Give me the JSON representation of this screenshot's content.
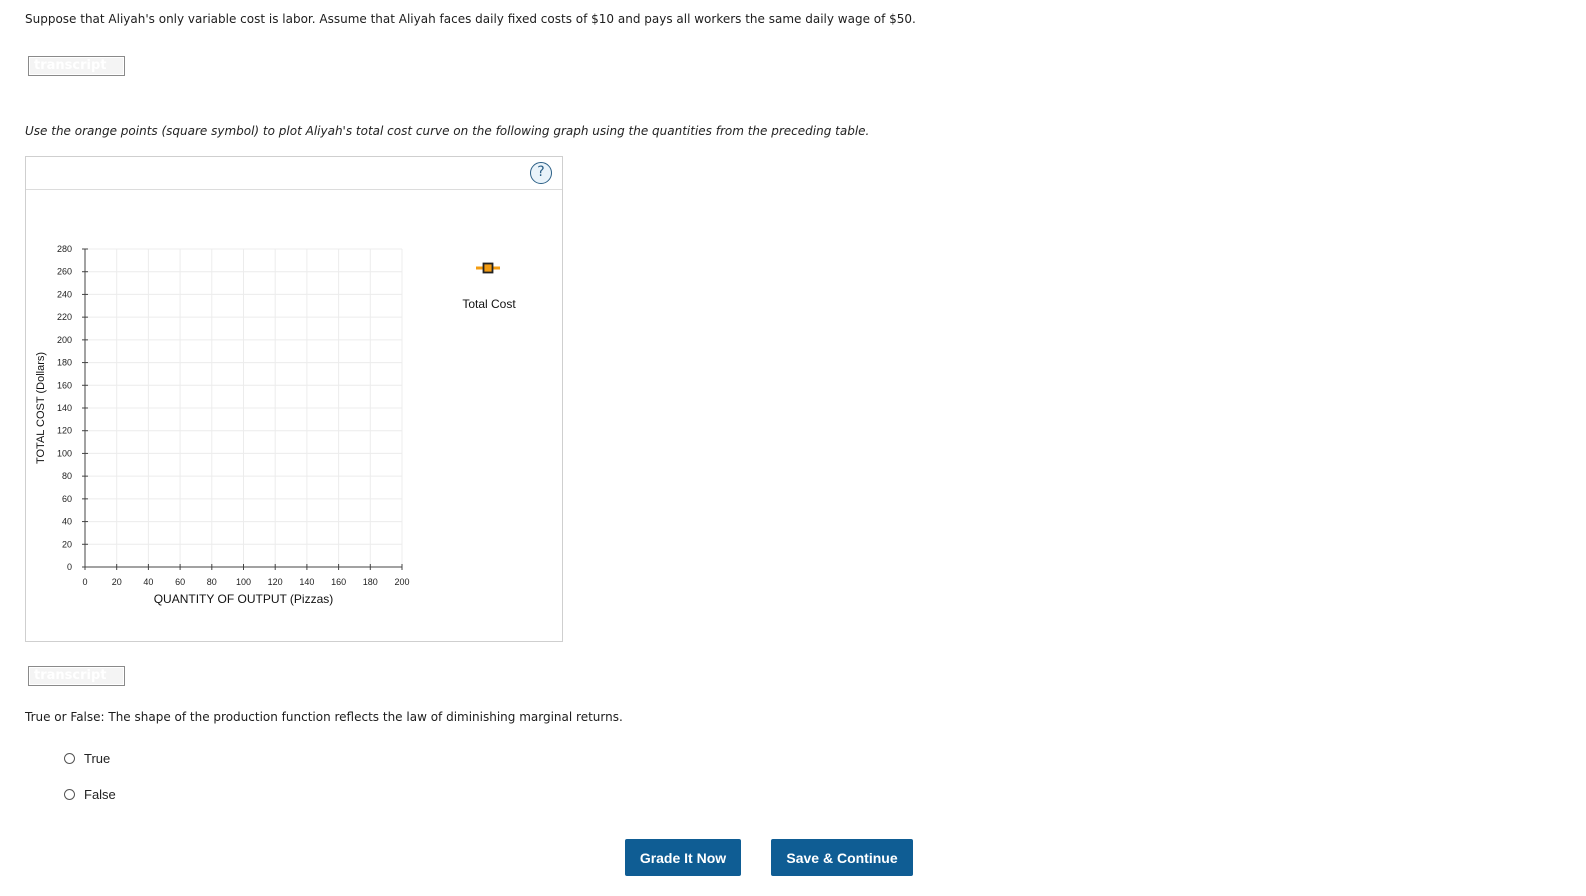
{
  "intro_text": "Suppose that Aliyah's only variable cost is labor. Assume that Aliyah faces daily fixed costs of $10 and pays all workers the same daily wage of $50.",
  "transcript_label": "transcript",
  "instruction_text": "Use the orange points (square symbol) to plot Aliyah's total cost curve on the following graph using the quantities from the preceding table.",
  "graph": {
    "help_label": "?",
    "tool": {
      "label": "Total Cost",
      "icon": "orange-square-point-icon",
      "color": "#f39c12",
      "marker_border": "#222222"
    }
  },
  "chart_data": {
    "type": "scatter",
    "xlabel": "QUANTITY OF OUTPUT (Pizzas)",
    "ylabel": "TOTAL COST (Dollars)",
    "xlim": [
      0,
      200
    ],
    "ylim": [
      0,
      280
    ],
    "xticks": [
      0,
      20,
      40,
      60,
      80,
      100,
      120,
      140,
      160,
      180,
      200
    ],
    "yticks": [
      0,
      20,
      40,
      60,
      80,
      100,
      120,
      140,
      160,
      180,
      200,
      220,
      240,
      260,
      280
    ],
    "grid": true,
    "series": []
  },
  "question": {
    "text": "True or False: The shape of the production function reflects the law of diminishing marginal returns.",
    "options": [
      "True",
      "False"
    ],
    "selected": null
  },
  "buttons": {
    "grade": "Grade It Now",
    "save": "Save & Continue"
  }
}
